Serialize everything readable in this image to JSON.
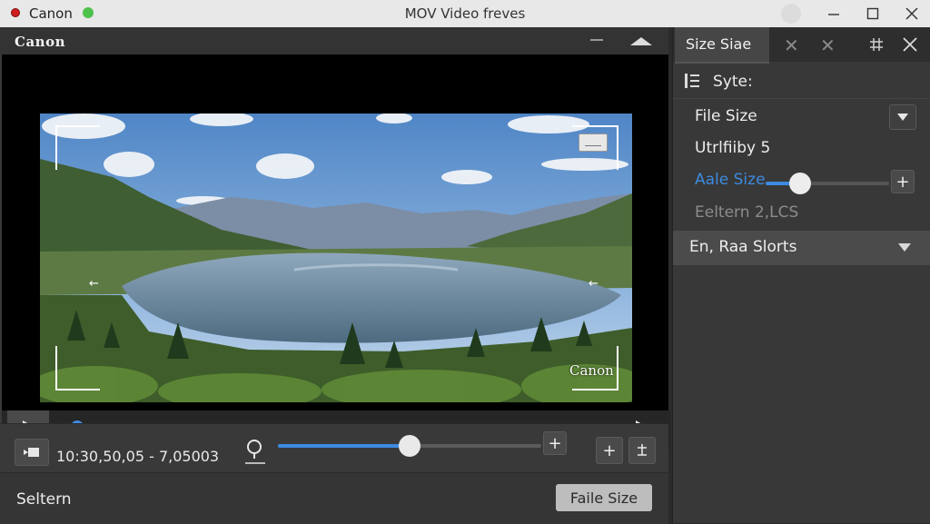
{
  "window": {
    "app_name": "Canon",
    "title": "MOV Video freves"
  },
  "video_panel": {
    "brand": "Canon",
    "watermark": "Canon",
    "playback_progress": 0.01
  },
  "toolbar": {
    "timecode": "10:30,50,05 - 7,05003",
    "volume_level": 0.5
  },
  "status": {
    "text": "Seltern",
    "button_label": "Faile Size"
  },
  "side_panel": {
    "tab_label": "Size Siae",
    "section_label": "Syte:",
    "file_size_label": "File Size",
    "info_line": "Utrlfiiby 5",
    "size_slider_label": "Aale Size",
    "size_slider_level": 0.28,
    "disabled_line": "Eeltern 2,LCS",
    "dropdown_label": "En, Raa Slorts"
  },
  "colors": {
    "accent": "#3d8be0",
    "record": "#d11d1d",
    "status_ok": "#4cc24c"
  }
}
